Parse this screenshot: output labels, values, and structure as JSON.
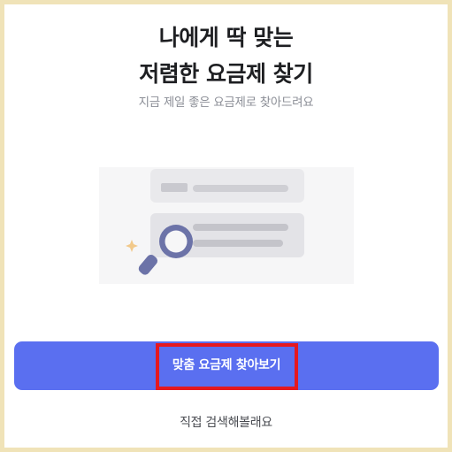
{
  "header": {
    "title_line1": "나에게 딱 맞는",
    "title_line2": "저렴한 요금제 찾기",
    "subtitle": "지금 제일 좋은 요금제로 찾아드려요"
  },
  "illustration": {
    "icon": "magnifier-search-icon"
  },
  "actions": {
    "primary_label": "맞춤 요금제 찾아보기",
    "secondary_label": "직접 검색해볼래요"
  },
  "colors": {
    "primary": "#5a6ff0",
    "highlight": "#e5181f",
    "frame": "#f0e3b8",
    "magnifier": "#6c73a8",
    "sparkle": "#f2c98a"
  }
}
